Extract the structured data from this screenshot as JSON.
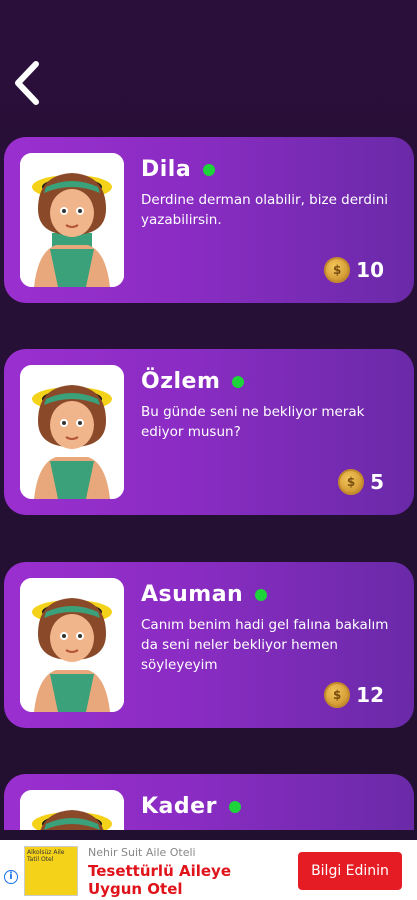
{
  "nav": {
    "back_icon": "chevron-left-icon"
  },
  "readers": [
    {
      "name": "Dila",
      "description": "Derdine derman olabilir, bize derdini yazabilirsin.",
      "price": "10",
      "online": true
    },
    {
      "name": "Özlem",
      "description": "Bu günde seni ne bekliyor merak ediyor musun?",
      "price": "5",
      "online": true
    },
    {
      "name": "Asuman",
      "description": "Canım benim hadi gel falına bakalım da seni neler bekliyor hemen söyleyeyim",
      "price": "12",
      "online": true
    },
    {
      "name": "Kader",
      "description": "",
      "price": "",
      "online": true
    }
  ],
  "ad": {
    "advertiser": "Nehir Suit Aile Oteli",
    "headline": "Tesettürlü Aileye Uygun Otel",
    "cta": "Bilgi Edinin",
    "thumb_text": "Alkolsüz Aile Tatil Otel",
    "info_icon": "info-icon"
  },
  "colors": {
    "card_start": "#9a2fcf",
    "card_end": "#6a2aa8",
    "online": "#1dd43a",
    "cta": "#e51c23"
  }
}
